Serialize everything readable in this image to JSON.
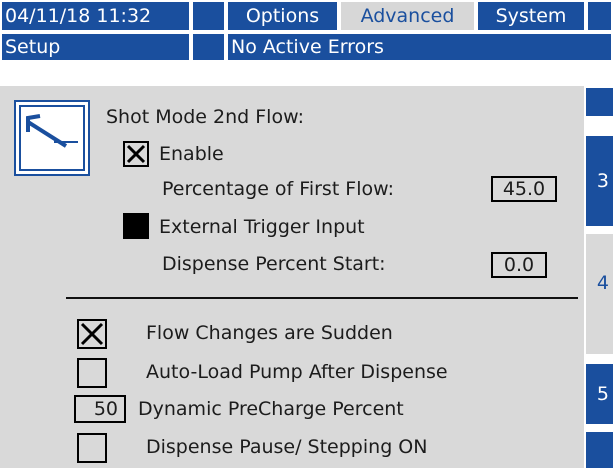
{
  "header": {
    "datetime": "04/11/18 11:32",
    "tabs": [
      {
        "label": "Options",
        "active": false
      },
      {
        "label": "Advanced",
        "active": true
      },
      {
        "label": "System",
        "active": false
      }
    ]
  },
  "status_bar": {
    "screen": "Setup",
    "message": "No Active Errors"
  },
  "shot_mode": {
    "title": "Shot Mode 2nd Flow:",
    "enable_label": "Enable",
    "enable_checked": true,
    "percentage_label": "Percentage of First Flow:",
    "percentage_value": "45.0",
    "external_trigger_label": "External Trigger Input",
    "external_trigger_filled": true,
    "dispense_start_label": "Dispense Percent Start:",
    "dispense_start_value": "0.0"
  },
  "options": {
    "flow_sudden_label": "Flow Changes are Sudden",
    "flow_sudden_checked": true,
    "autoload_label": "Auto-Load Pump After Dispense",
    "autoload_checked": false,
    "precharge_label": "Dynamic PreCharge Percent",
    "precharge_value": "50",
    "pause_label": "Dispense Pause/ Stepping ON",
    "pause_checked": false
  },
  "side_pages": [
    {
      "label": "3",
      "active": false
    },
    {
      "label": "4",
      "active": true
    },
    {
      "label": "5",
      "active": false
    }
  ],
  "colors": {
    "accent": "#1a4f9e",
    "panel": "#d9d9d9"
  },
  "icons": {
    "setup_icon": "screen-mode-icon"
  }
}
